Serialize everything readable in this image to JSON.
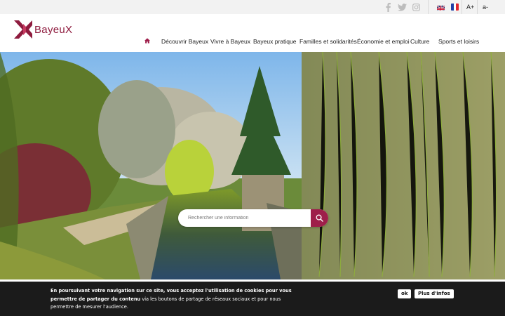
{
  "brand": {
    "name": "BayeuX",
    "color": "#8e1b3e",
    "accent": "#9e1e4a"
  },
  "utility_bar": {
    "social": [
      "facebook-icon",
      "twitter-icon",
      "instagram-icon"
    ],
    "languages": [
      "english-flag-icon",
      "french-flag-icon"
    ],
    "font_increase_label": "A+",
    "font_decrease_label": "a-"
  },
  "nav": {
    "home_icon": "home-icon",
    "items": [
      "Découvrir Bayeux",
      "Vivre à Bayeux",
      "Bayeux pratique",
      "Familles et solidarités",
      "Économie et emploi",
      "Culture",
      "Sports et loisirs"
    ]
  },
  "search": {
    "placeholder": "Rechercher une information",
    "button_icon": "search-icon"
  },
  "cookie": {
    "text_bold": "En poursuivant votre navigation sur ce site, vous acceptez l'utilisation de cookies pour vous permettre de partager du contenu",
    "text_rest": " via les boutons de partage de réseaux sociaux et pour nous permettre de mesurer l'audience.",
    "ok_label": "ok",
    "more_label": "Plus d'infos"
  }
}
